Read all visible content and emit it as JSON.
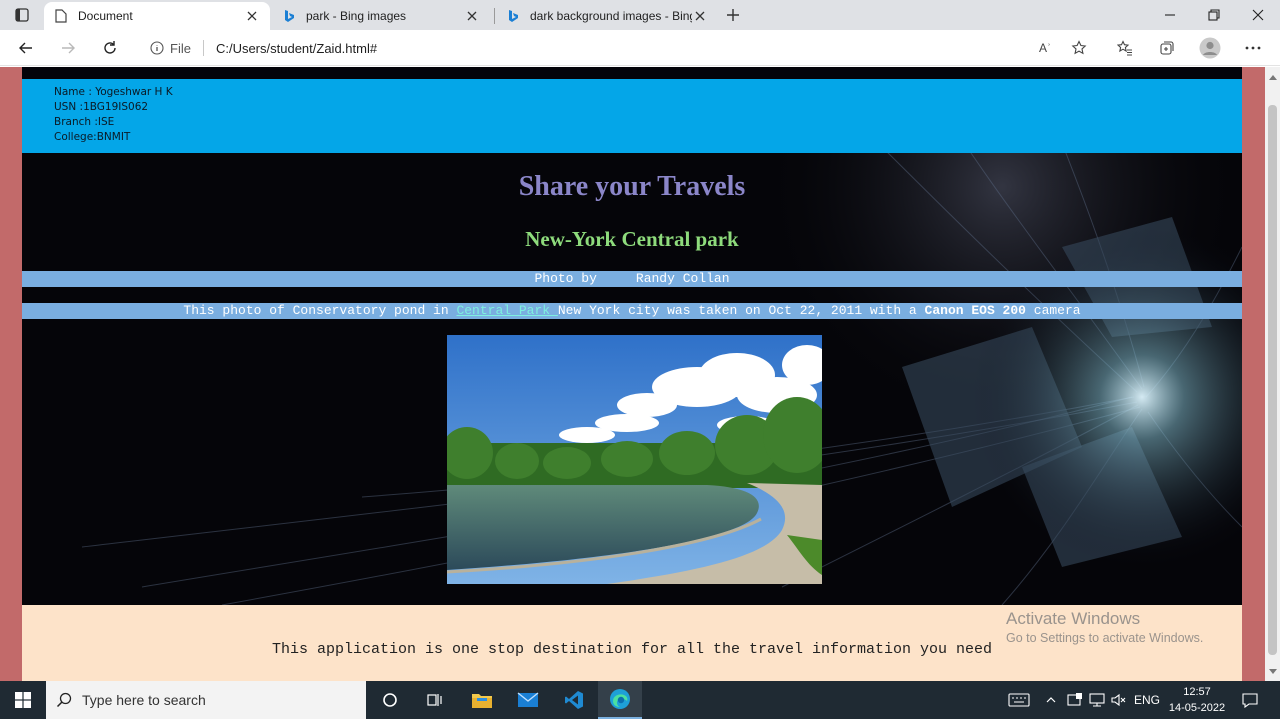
{
  "browser": {
    "tabs": [
      {
        "label": "Document",
        "icon": "document-icon",
        "active": true
      },
      {
        "label": "park - Bing images",
        "icon": "bing-icon",
        "active": false
      },
      {
        "label": "dark background images - Bing",
        "icon": "bing-icon",
        "active": false
      }
    ],
    "address": {
      "site_info_label": "File",
      "url": "C:/Users/student/Zaid.html#"
    },
    "read_aloud_label": "Aʾ"
  },
  "page": {
    "student": {
      "name": "Name : Yogeshwar H K",
      "usn": "USN :1BG19IS062",
      "branch": "Branch :ISE",
      "college": "College:BNMIT"
    },
    "heading": "Share your Travels",
    "subheading": "New-York Central park",
    "photo_by": {
      "prefix": "Photo by",
      "author": "Randy Collan"
    },
    "description": {
      "before_link": "This photo of Conservatory pond in ",
      "link": "Central Park ",
      "after_link": "New York city was taken on Oct 22, 2011 with a ",
      "camera": "Canon EOS 200",
      "end": " camera"
    },
    "tagline": "This application is one stop destination for all the travel information you need",
    "colors": {
      "student_banner": "#04a6e8",
      "heading": "#8b86c9",
      "subheading": "#8edb7c",
      "info_bar": "#7aaee0",
      "footer": "#fde3c9",
      "page_border": "#c26a6a"
    }
  },
  "watermark": {
    "line1": "Activate Windows",
    "line2": "Go to Settings to activate Windows."
  },
  "taskbar": {
    "search_placeholder": "Type here to search",
    "language": "ENG",
    "time": "12:57",
    "date": "14-05-2022"
  }
}
